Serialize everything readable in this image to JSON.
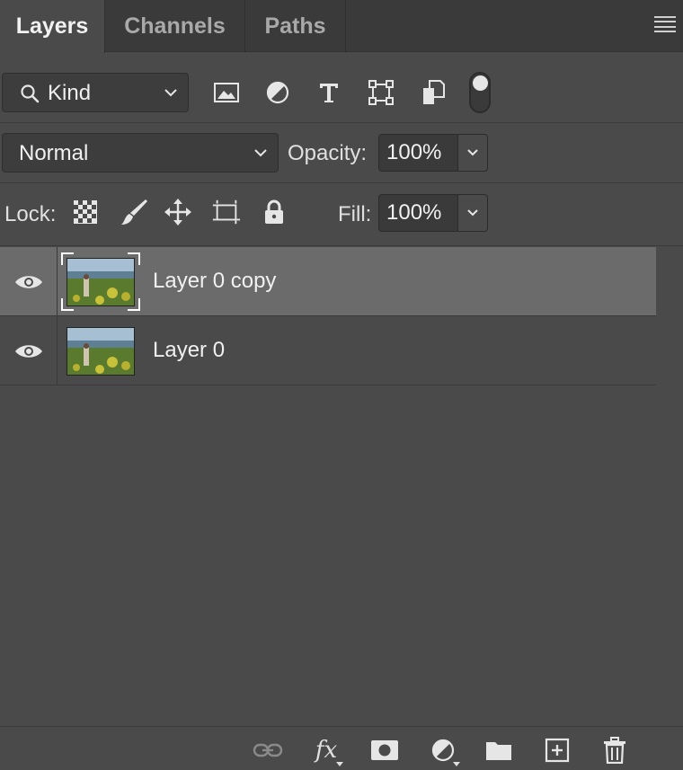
{
  "tabs": [
    {
      "label": "Layers",
      "active": true
    },
    {
      "label": "Channels",
      "active": false
    },
    {
      "label": "Paths",
      "active": false
    }
  ],
  "filter": {
    "kind_label": "Kind",
    "icons": [
      "image-filter-icon",
      "adjustment-filter-icon",
      "type-filter-icon",
      "shape-filter-icon",
      "smart-object-filter-icon"
    ]
  },
  "blend": {
    "mode": "Normal",
    "opacity_label": "Opacity:",
    "opacity_value": "100%"
  },
  "lock": {
    "label": "Lock:",
    "fill_label": "Fill:",
    "fill_value": "100%"
  },
  "layers": [
    {
      "name": "Layer 0 copy",
      "visible": true,
      "selected": true
    },
    {
      "name": "Layer 0",
      "visible": true,
      "selected": false
    }
  ],
  "footer_icons": [
    "link-layers-icon",
    "fx-icon",
    "layer-mask-icon",
    "adjustment-layer-icon",
    "new-group-icon",
    "new-layer-icon",
    "delete-layer-icon"
  ],
  "footer": {
    "fx_label": "fx"
  },
  "colors": {
    "panel_bg": "#4a4a4a",
    "selected_row": "#6b6b6b",
    "tab_bar": "#3a3a3a"
  }
}
